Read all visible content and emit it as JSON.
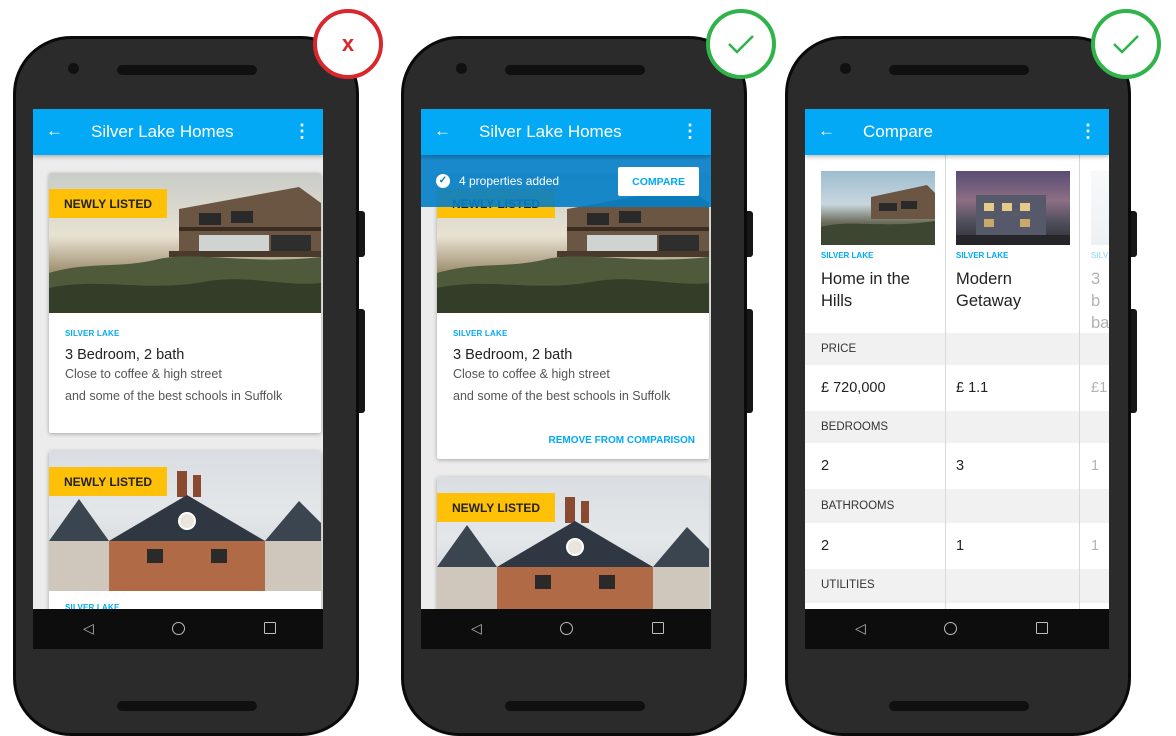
{
  "phones": [
    {
      "appbar": {
        "back_icon": "←",
        "title": "Silver Lake Homes",
        "more_icon": "⋮"
      },
      "cards": [
        {
          "badge": "NEWLY LISTED",
          "subtitle": "SILVER LAKE",
          "title": "3 Bedroom, 2 bath",
          "desc1": "Close to coffee & high street",
          "desc2": "and some of the best schools in Suffolk"
        },
        {
          "badge": "NEWLY LISTED",
          "subtitle": "SILVER LAKE"
        }
      ],
      "verdict": "x",
      "verdict_icon": "cross-mark-icon",
      "verdict_color": "#d9272e"
    },
    {
      "appbar": {
        "back_icon": "←",
        "title": "Silver Lake Homes",
        "more_icon": "⋮"
      },
      "toast": {
        "text": "4 properties added",
        "button": "COMPARE"
      },
      "cards": [
        {
          "badge": "NEWLY LISTED",
          "subtitle": "SILVER LAKE",
          "title": "3 Bedroom, 2 bath",
          "desc1": "Close to coffee & high street",
          "desc2": "and some of the best schools in Suffolk",
          "action": "REMOVE FROM COMPARISON"
        },
        {
          "badge": "NEWLY LISTED"
        }
      ],
      "verdict": "check",
      "verdict_icon": "check-mark-icon",
      "verdict_color": "#2fb34a"
    },
    {
      "appbar": {
        "back_icon": "←",
        "title": "Compare",
        "more_icon": "⋮"
      },
      "compare": {
        "columns": [
          {
            "subtitle": "SILVER LAKE",
            "title": "Home in the Hills",
            "price": "£ 720,000",
            "bedrooms": "2",
            "bathrooms": "2"
          },
          {
            "subtitle": "SILVER LAKE",
            "title": "Modern Getaway",
            "price": "£ 1.1",
            "bedrooms": "3",
            "bathrooms": "1"
          },
          {
            "subtitle": "SILV",
            "title": "3 b ba",
            "price": "£1",
            "bedrooms": "1",
            "bathrooms": "1"
          }
        ],
        "row_labels": {
          "price": "PRICE",
          "bedrooms": "BEDROOMS",
          "bathrooms": "BATHROOMS",
          "utilities": "UTILITIES"
        }
      },
      "verdict": "check",
      "verdict_icon": "check-mark-icon",
      "verdict_color": "#2fb34a"
    }
  ],
  "colors": {
    "primary": "#03a9f4",
    "badge": "#ffc107",
    "error": "#d9272e",
    "success": "#2fb34a"
  }
}
